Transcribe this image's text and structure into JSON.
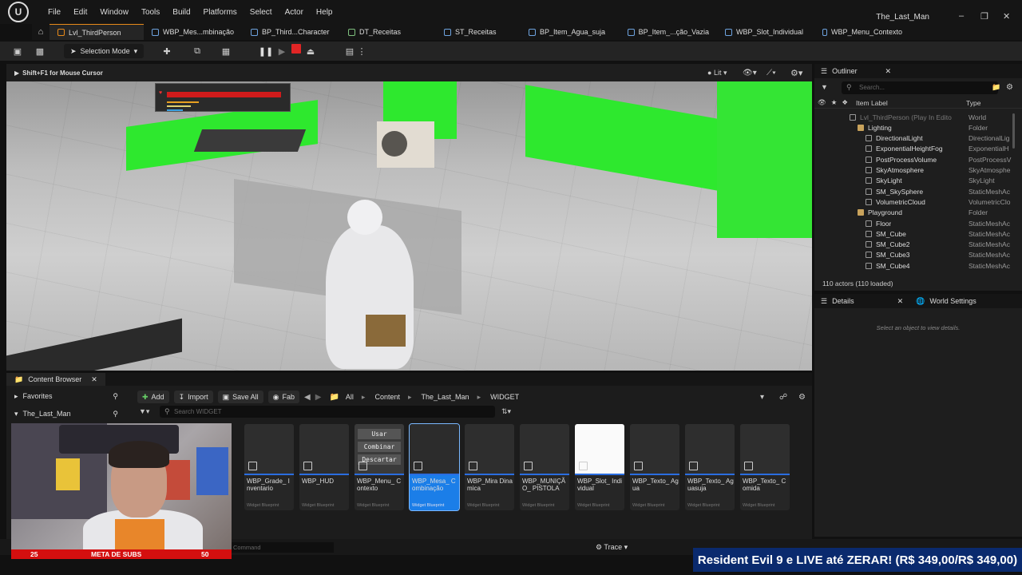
{
  "menu": {
    "items": [
      "File",
      "Edit",
      "Window",
      "Tools",
      "Build",
      "Platforms",
      "Select",
      "Actor",
      "Help"
    ],
    "project_title": "The_Last_Man"
  },
  "tabs": [
    {
      "label": "Lvl_ThirdPerson",
      "active": true
    },
    {
      "label": "WBP_Mes...mbinação"
    },
    {
      "label": "BP_Third...Character"
    },
    {
      "label": "DT_Receitas"
    },
    {
      "label": "ST_Receitas"
    },
    {
      "label": "BP_Item_Agua_suja"
    },
    {
      "label": "BP_Item_...ção_Vazia"
    },
    {
      "label": "WBP_Slot_Individual"
    },
    {
      "label": "WBP_Menu_Contexto"
    }
  ],
  "toolbar": {
    "selection_mode": "Selection Mode"
  },
  "viewport": {
    "hint": "Shift+F1 for Mouse Cursor",
    "view_mode": "Lit",
    "health_fraction": 0.95
  },
  "outliner": {
    "tab": "Outliner",
    "search_placeholder": "Search...",
    "col_label": "Item Label",
    "col_type": "Type",
    "rows": [
      {
        "label": "Lvl_ThirdPerson (Play In Edito",
        "type": "World",
        "indent": 0,
        "kind": "world"
      },
      {
        "label": "Lighting",
        "type": "Folder",
        "indent": 1,
        "kind": "folder"
      },
      {
        "label": "DirectionalLight",
        "type": "DirectionalLig",
        "indent": 2,
        "kind": "actor"
      },
      {
        "label": "ExponentialHeightFog",
        "type": "ExponentialH",
        "indent": 2,
        "kind": "actor"
      },
      {
        "label": "PostProcessVolume",
        "type": "PostProcessV",
        "indent": 2,
        "kind": "actor"
      },
      {
        "label": "SkyAtmosphere",
        "type": "SkyAtmosphe",
        "indent": 2,
        "kind": "actor"
      },
      {
        "label": "SkyLight",
        "type": "SkyLight",
        "indent": 2,
        "kind": "actor"
      },
      {
        "label": "SM_SkySphere",
        "type": "StaticMeshAc",
        "indent": 2,
        "kind": "actor"
      },
      {
        "label": "VolumetricCloud",
        "type": "VolumetricClo",
        "indent": 2,
        "kind": "actor"
      },
      {
        "label": "Playground",
        "type": "Folder",
        "indent": 1,
        "kind": "folder"
      },
      {
        "label": "Floor",
        "type": "StaticMeshAc",
        "indent": 2,
        "kind": "actor"
      },
      {
        "label": "SM_Cube",
        "type": "StaticMeshAc",
        "indent": 2,
        "kind": "actor"
      },
      {
        "label": "SM_Cube2",
        "type": "StaticMeshAc",
        "indent": 2,
        "kind": "actor"
      },
      {
        "label": "SM_Cube3",
        "type": "StaticMeshAc",
        "indent": 2,
        "kind": "actor"
      },
      {
        "label": "SM_Cube4",
        "type": "StaticMeshAc",
        "indent": 2,
        "kind": "actor"
      }
    ],
    "actor_count": "110 actors (110 loaded)"
  },
  "details": {
    "tab": "Details",
    "world_settings_tab": "World Settings",
    "empty_text": "Select an object to view details."
  },
  "content_browser": {
    "tab": "Content Browser",
    "favorites": "Favorites",
    "root": "The_Last_Man",
    "add": "Add",
    "import": "Import",
    "save_all": "Save All",
    "fab": "Fab",
    "breadcrumb": [
      "All",
      "Content",
      "The_Last_Man",
      "WIDGET"
    ],
    "search_placeholder": "Search WIDGET",
    "assets": [
      {
        "name": "WBP_Grade_ Inventario",
        "type": "Widget Blueprint"
      },
      {
        "name": "WBP_HUD",
        "type": "Widget Blueprint"
      },
      {
        "name": "WBP_Menu_ Contexto",
        "type": "Widget Blueprint",
        "preview": [
          "Usar",
          "Combinar",
          "Descartar"
        ]
      },
      {
        "name": "WBP_Mesa_ Combinação",
        "type": "Widget Blueprint",
        "selected": true
      },
      {
        "name": "WBP_Mira Dinamica",
        "type": "Widget Blueprint"
      },
      {
        "name": "WBP_MUNIÇÃO_ PISTOLA",
        "type": "Widget Blueprint"
      },
      {
        "name": "WBP_Slot_ Individual",
        "type": "Widget Blueprint",
        "white": true
      },
      {
        "name": "WBP_Texto_ Agua",
        "type": "Widget Blueprint"
      },
      {
        "name": "WBP_Texto_ Aguasuja",
        "type": "Widget Blueprint"
      },
      {
        "name": "WBP_Texto_ Comida",
        "type": "Widget Blueprint"
      }
    ]
  },
  "status": {
    "cmd_placeholder": "Command",
    "trace": "Trace"
  },
  "stream": {
    "subs_current": "25",
    "subs_label": "META DE SUBS",
    "subs_goal": "50",
    "banner": "Resident Evil 9 e LIVE até ZERAR! (R$ 349,00/R$ 349,00)"
  },
  "colors": {
    "accent_blue": "#1b7ee8",
    "tab_accent": "#e88a1a",
    "health_red": "#d01b1b",
    "chroma_green": "#2ee82e",
    "banner_blue": "#0a2a6e"
  }
}
